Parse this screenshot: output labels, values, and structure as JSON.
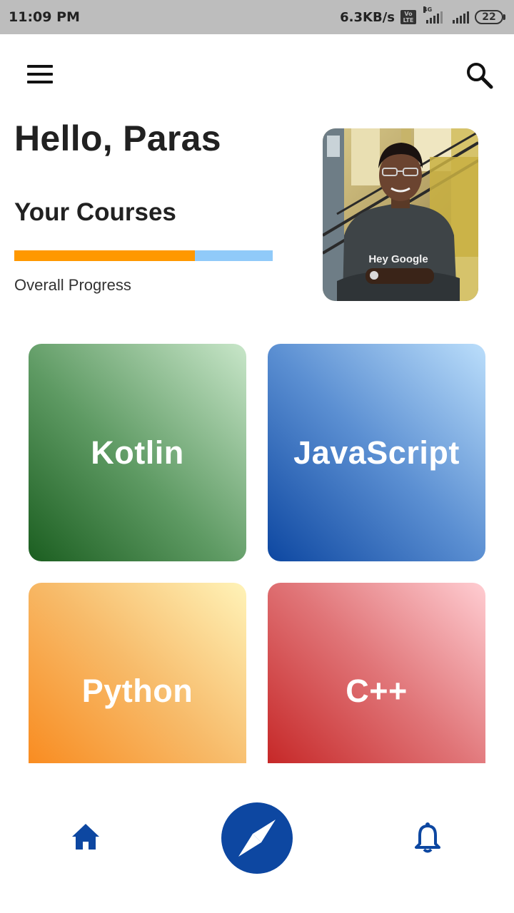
{
  "status_bar": {
    "time": "11:09 PM",
    "network_speed": "6.3KB/s",
    "volte_top": "Vo",
    "volte_bottom": "LTE",
    "network_type": "4G",
    "battery": "22"
  },
  "app_bar": {
    "menu_icon": "menu-icon",
    "search_icon": "search-icon"
  },
  "header": {
    "greeting": "Hello, Paras",
    "section_title": "Your Courses",
    "progress_label": "Overall Progress",
    "progress_value": 0.7,
    "shirt_text": "Hey Google"
  },
  "courses": [
    {
      "label": "Kotlin"
    },
    {
      "label": "JavaScript"
    },
    {
      "label": "Python"
    },
    {
      "label": "C++"
    }
  ],
  "bottom_nav": {
    "items": [
      {
        "icon": "home-icon"
      },
      {
        "icon": "compass-icon"
      },
      {
        "icon": "bell-icon"
      }
    ]
  },
  "colors": {
    "primary": "#0d47a1",
    "progress_fill": "#ff9800",
    "progress_track": "#90caf9",
    "status_bar": "#bdbdbd"
  }
}
